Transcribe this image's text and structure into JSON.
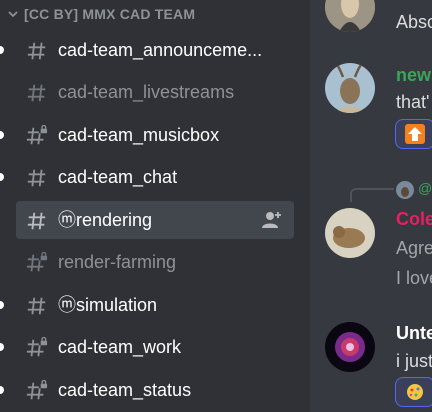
{
  "sidebar": {
    "category_label": "[CC BY] MMX CAD TEAM",
    "channels": [
      {
        "label": "cad-team_announceme...",
        "state": "unread",
        "icon": "hash-icon"
      },
      {
        "label": "cad-team_livestreams",
        "state": "muted",
        "icon": "hash-icon"
      },
      {
        "label": "cad-team_musicbox",
        "state": "unread",
        "icon": "locked-hash-icon"
      },
      {
        "label": "cad-team_chat",
        "state": "unread",
        "icon": "hash-icon"
      },
      {
        "label": "ⓜrendering",
        "state": "active",
        "icon": "hash-icon"
      },
      {
        "label": "render-farming",
        "state": "muted",
        "icon": "locked-hash-icon"
      },
      {
        "label": "ⓜsimulation",
        "state": "unread",
        "icon": "hash-icon"
      },
      {
        "label": "cad-team_work",
        "state": "unread",
        "icon": "locked-hash-icon"
      },
      {
        "label": "cad-team_status",
        "state": "unread",
        "icon": "locked-hash-icon"
      }
    ]
  },
  "chat": {
    "messages": [
      {
        "text": "Abso"
      },
      {
        "username": "news",
        "text": "that'",
        "reaction": "up-arrow-emoji",
        "username_color": "#3ba55c"
      },
      {
        "reply_prefix": "@",
        "username": "Cole",
        "lines": [
          "Agre",
          "I love"
        ],
        "username_color": "#e91e63"
      },
      {
        "username": "Unte",
        "text": "i just",
        "reaction": "party-emoji",
        "username_color": "#ffffff"
      }
    ]
  },
  "colors": {
    "sidebar_bg": "#2f3136",
    "chat_bg": "#36393f",
    "active_channel_bg": "#42464d",
    "text_bright": "#ffffff",
    "text_muted": "#8e9297",
    "reaction_border": "#5865f2"
  }
}
